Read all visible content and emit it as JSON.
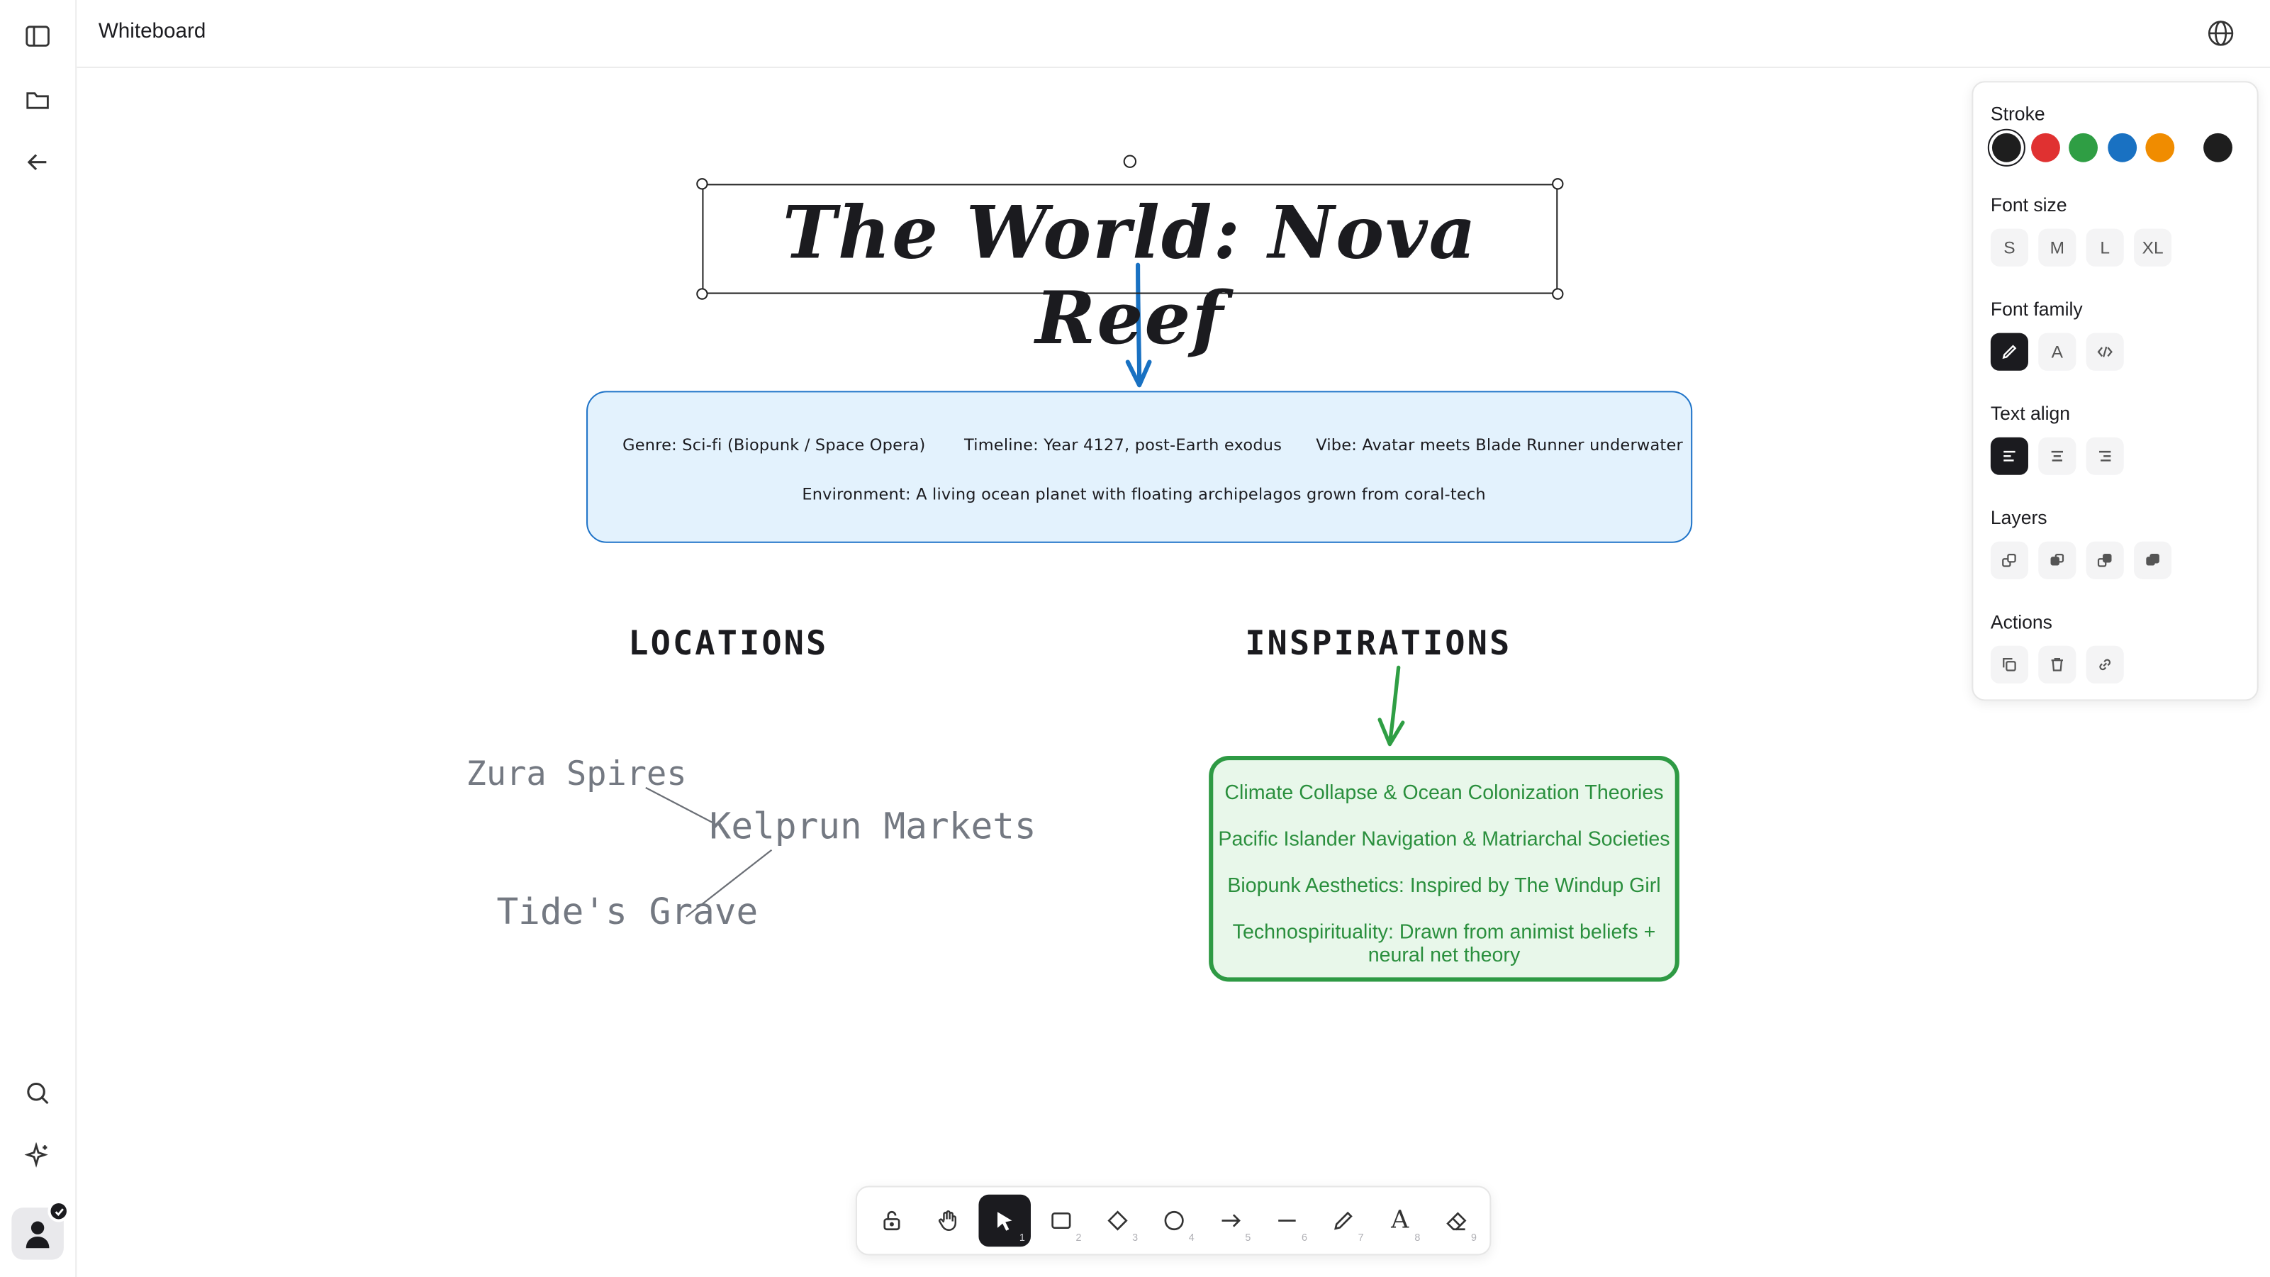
{
  "app": {
    "title": "Whiteboard"
  },
  "left_rail": {
    "icons": [
      "sidebar-toggle-icon",
      "folder-icon",
      "arrow-left-icon",
      "search-icon",
      "sparkle-icon",
      "user-avatar"
    ]
  },
  "canvas": {
    "title": "The World: Nova Reef",
    "genre_box": {
      "line1_genre": "Genre: Sci-fi (Biopunk / Space Opera)",
      "line1_timeline": "Timeline: Year 4127, post-Earth exodus",
      "line1_vibe": "Vibe: Avatar meets Blade Runner underwater",
      "line2": "Environment: A living ocean planet with floating archipelagos grown from coral-tech"
    },
    "locations_heading": "LOCATIONS",
    "inspirations_heading": "INSPIRATIONS",
    "locations": [
      "Zura Spires",
      "Kelprun Markets",
      "Tide's Grave"
    ],
    "inspirations": [
      "Climate Collapse & Ocean Colonization Theories",
      "Pacific Islander Navigation & Matriarchal Societies",
      "Biopunk Aesthetics: Inspired by The Windup Girl",
      "Technospirituality: Drawn from animist beliefs +",
      "neural net theory"
    ]
  },
  "panel": {
    "stroke_label": "Stroke",
    "stroke_colors": [
      "#1e1e1e",
      "#e03131",
      "#2f9e44",
      "#1971c2",
      "#f08c00",
      "#1e1e1e"
    ],
    "font_size_label": "Font size",
    "font_sizes": [
      "S",
      "M",
      "L",
      "XL"
    ],
    "font_family_label": "Font family",
    "font_family_glyph_normal": "A",
    "text_align_label": "Text align",
    "layers_label": "Layers",
    "actions_label": "Actions"
  },
  "toolbar": {
    "tools": [
      {
        "name": "lock",
        "key": ""
      },
      {
        "name": "hand",
        "key": ""
      },
      {
        "name": "select",
        "key": "1"
      },
      {
        "name": "rectangle",
        "key": "2"
      },
      {
        "name": "diamond",
        "key": "3"
      },
      {
        "name": "ellipse",
        "key": "4"
      },
      {
        "name": "arrow",
        "key": "5"
      },
      {
        "name": "line",
        "key": "6"
      },
      {
        "name": "pencil",
        "key": "7"
      },
      {
        "name": "text",
        "key": "8"
      },
      {
        "name": "eraser",
        "key": "9"
      }
    ],
    "text_glyph": "A"
  }
}
